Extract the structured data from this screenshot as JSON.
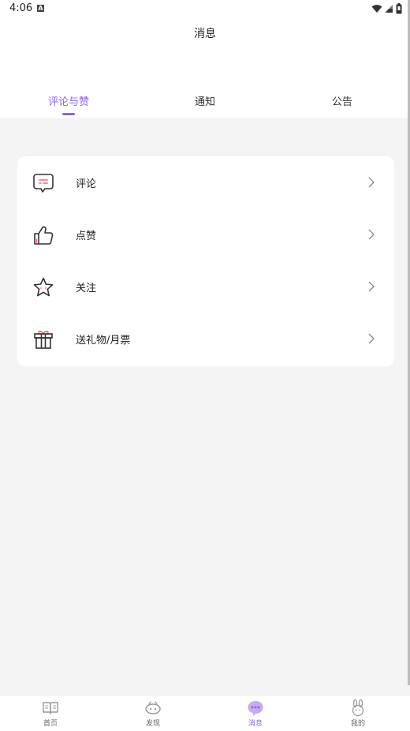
{
  "status_bar": {
    "time": "4:06",
    "notification_icon_letter": "A"
  },
  "header": {
    "title": "消息",
    "tabs": [
      {
        "label": "评论与赞",
        "active": true
      },
      {
        "label": "通知",
        "active": false
      },
      {
        "label": "公告",
        "active": false
      }
    ]
  },
  "menu": {
    "items": [
      {
        "label": "评论",
        "icon": "comment-icon"
      },
      {
        "label": "点赞",
        "icon": "thumbs-up-icon"
      },
      {
        "label": "关注",
        "icon": "star-icon"
      },
      {
        "label": "送礼物/月票",
        "icon": "gift-icon"
      }
    ]
  },
  "bottom_nav": {
    "items": [
      {
        "label": "首页",
        "icon": "book-icon",
        "active": false
      },
      {
        "label": "发现",
        "icon": "discover-icon",
        "active": false
      },
      {
        "label": "消息",
        "icon": "message-icon",
        "active": true
      },
      {
        "label": "我的",
        "icon": "bunny-icon",
        "active": false
      }
    ]
  },
  "colors": {
    "accent": "#8a63e8",
    "icon_accent_pink": "#e86a7a",
    "background": "#f4f4f4"
  }
}
